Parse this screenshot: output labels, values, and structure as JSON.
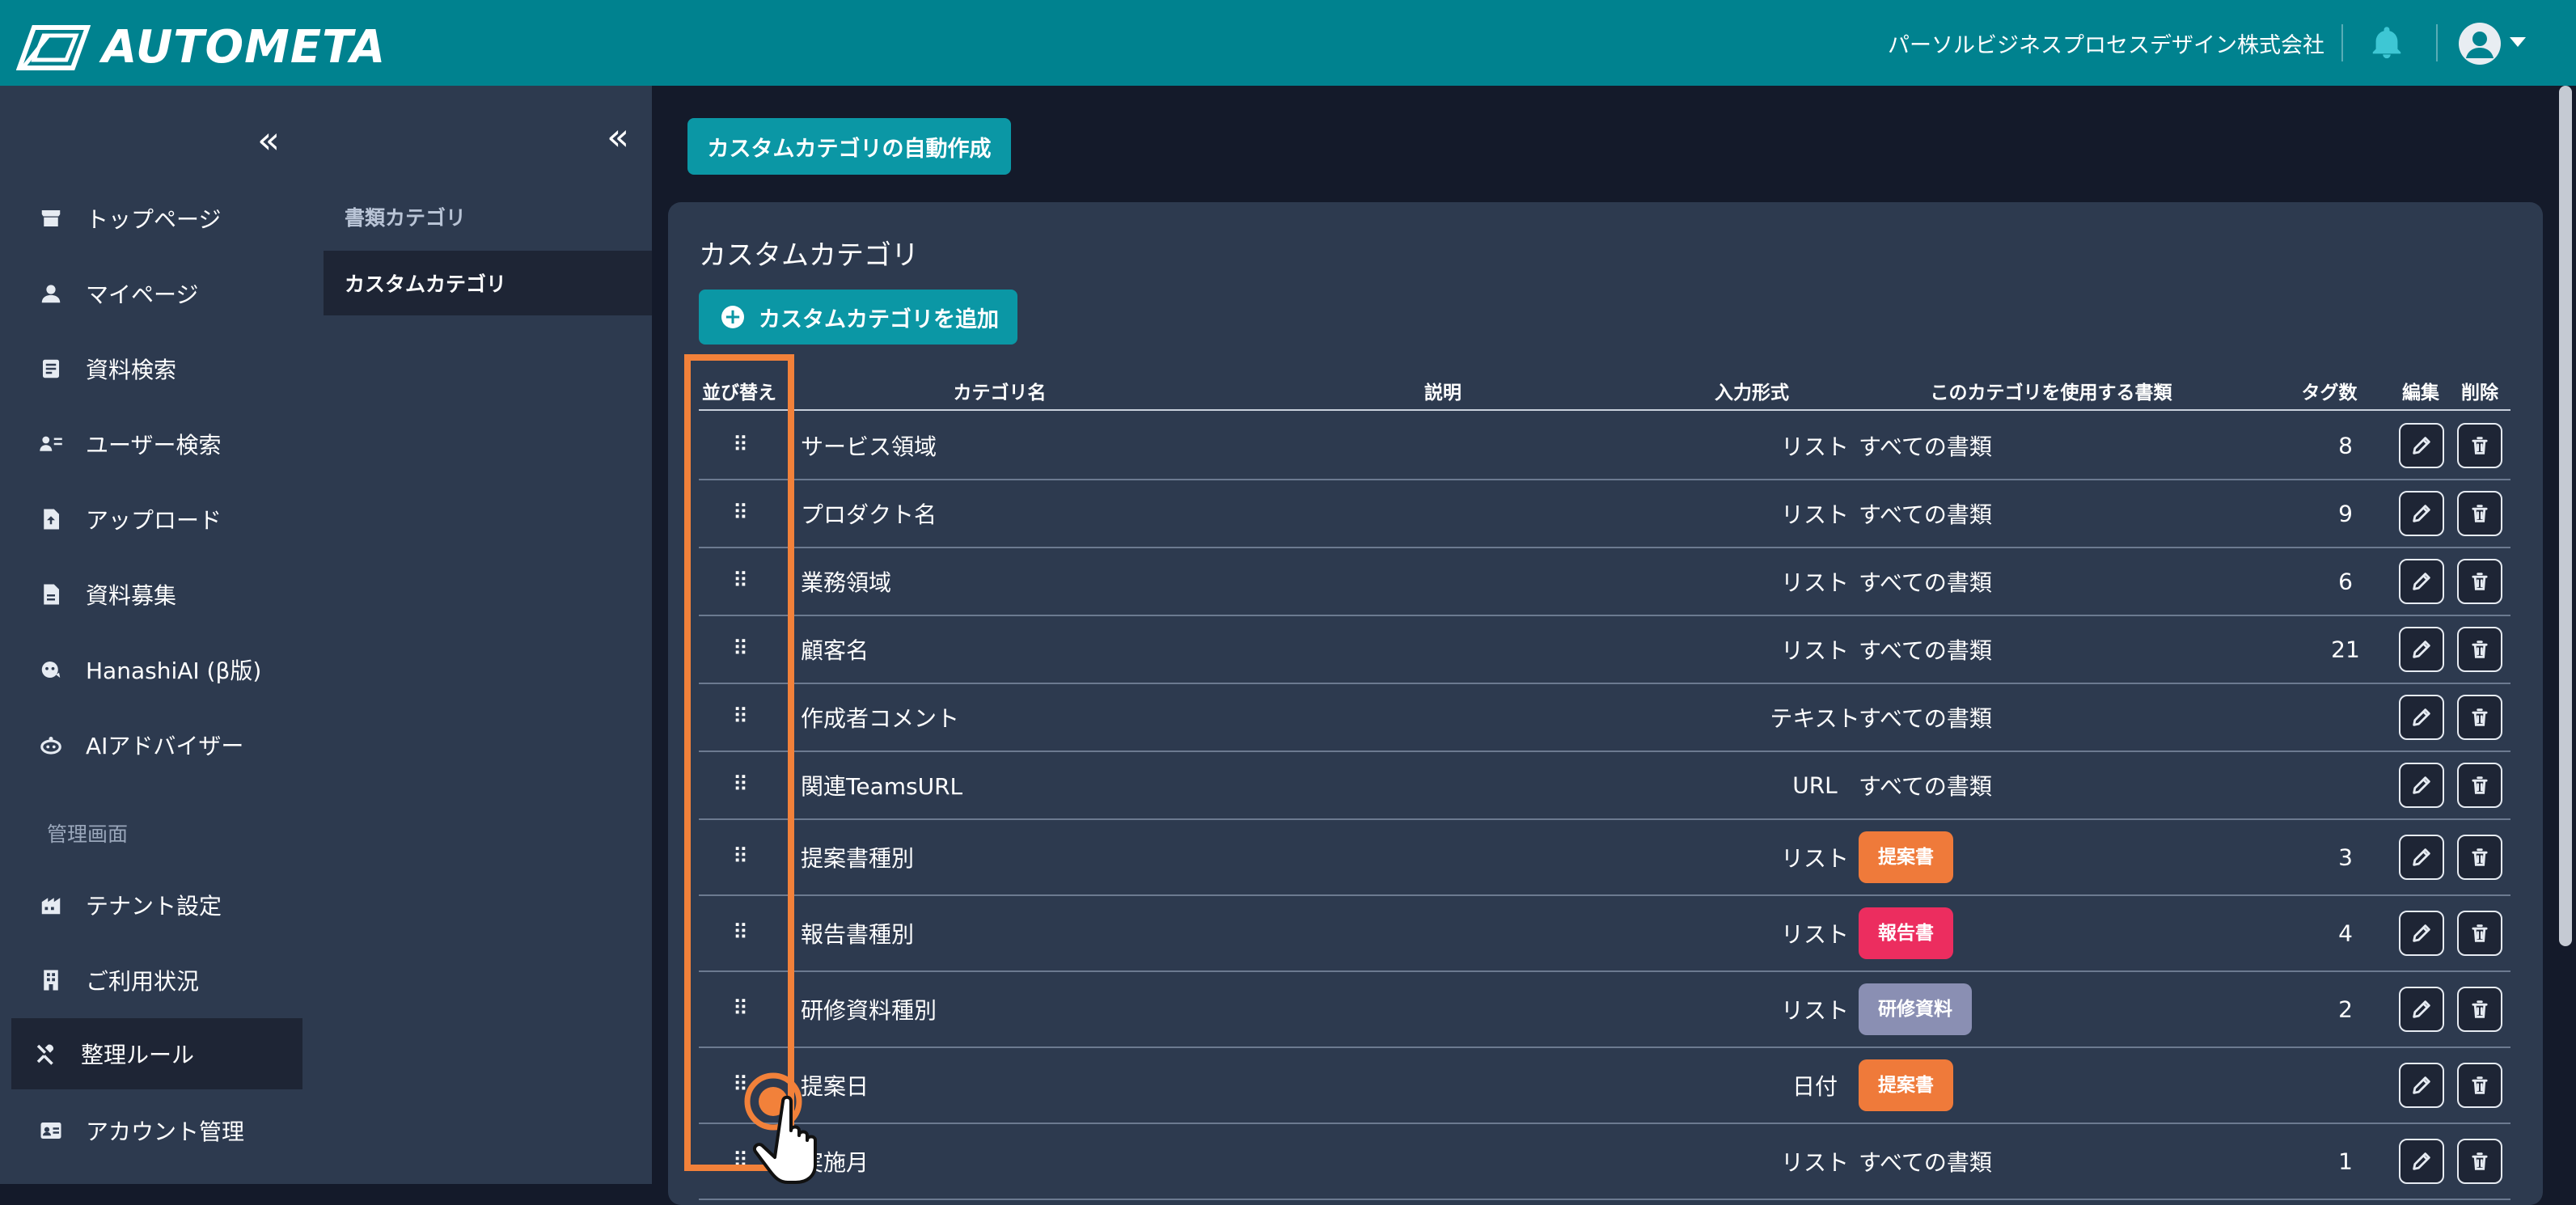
{
  "header": {
    "logo_text": "AUTOMETA",
    "company": "パーソルビジネスプロセスデザイン株式会社",
    "bar_color": "#00828f"
  },
  "sidebar": {
    "items": [
      {
        "label": "トップページ",
        "icon": "store-icon"
      },
      {
        "label": "マイページ",
        "icon": "person-icon"
      },
      {
        "label": "資料検索",
        "icon": "document-search-icon"
      },
      {
        "label": "ユーザー検索",
        "icon": "user-list-icon"
      },
      {
        "label": "アップロード",
        "icon": "file-upload-icon"
      },
      {
        "label": "資料募集",
        "icon": "file-icon"
      },
      {
        "label": "HanashiAI (β版)",
        "icon": "chat-bot-icon"
      },
      {
        "label": "AIアドバイザー",
        "icon": "robot-icon"
      },
      {
        "label": "テナント設定",
        "icon": "building-icon"
      },
      {
        "label": "ご利用状況",
        "icon": "office-icon"
      },
      {
        "label": "整理ルール",
        "icon": "tools-icon"
      },
      {
        "label": "アカウント管理",
        "icon": "id-card-icon"
      }
    ],
    "section_label": "管理画面",
    "active": "整理ルール"
  },
  "subnav": {
    "items": [
      {
        "label": "書類カテゴリ"
      },
      {
        "label": "カスタムカテゴリ"
      }
    ],
    "active": "カスタムカテゴリ"
  },
  "main": {
    "auto_create_label": "カスタムカテゴリの自動作成",
    "card_title": "カスタムカテゴリ",
    "add_label": "カスタムカテゴリを追加",
    "columns": {
      "sort": "並び替え",
      "name": "カテゴリ名",
      "description": "説明",
      "input_type": "入力形式",
      "docs": "このカテゴリを使用する書類",
      "tag_count": "タグ数",
      "edit": "編集",
      "delete": "削除"
    },
    "rows": [
      {
        "name": "サービス領域",
        "type": "リスト",
        "docs": "すべての書類",
        "tags": "8"
      },
      {
        "name": "プロダクト名",
        "type": "リスト",
        "docs": "すべての書類",
        "tags": "9"
      },
      {
        "name": "業務領域",
        "type": "リスト",
        "docs": "すべての書類",
        "tags": "6"
      },
      {
        "name": "顧客名",
        "type": "リスト",
        "docs": "すべての書類",
        "tags": "21"
      },
      {
        "name": "作成者コメント",
        "type": "テキスト",
        "docs": "すべての書類",
        "tags": ""
      },
      {
        "name": "関連TeamsURL",
        "type": "URL",
        "docs": "すべての書類",
        "tags": ""
      },
      {
        "name": "提案書種別",
        "type": "リスト",
        "badge": "提案書",
        "badge_color": "#ef7a3a",
        "tags": "3"
      },
      {
        "name": "報告書種別",
        "type": "リスト",
        "badge": "報告書",
        "badge_color": "#ec2d5f",
        "tags": "4"
      },
      {
        "name": "研修資料種別",
        "type": "リスト",
        "badge": "研修資料",
        "badge_color": "#8a8fb3",
        "tags": "2"
      },
      {
        "name": "提案日",
        "type": "日付",
        "badge": "提案書",
        "badge_color": "#ef7a3a",
        "tags": ""
      },
      {
        "name": "実施月",
        "type": "リスト",
        "docs": "すべての書類",
        "tags": "1"
      }
    ]
  },
  "colors": {
    "accent": "#0b97a5",
    "highlight": "#f2813a"
  }
}
